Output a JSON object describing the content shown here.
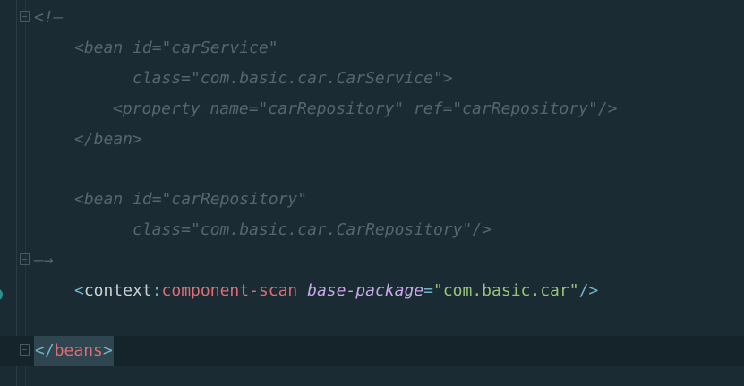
{
  "editor": {
    "lines": {
      "comment_open": "<!—",
      "bean1_open": "<bean id=\"carService\"",
      "bean1_class": "class=\"com.basic.car.CarService\">",
      "bean1_prop": "<property name=\"carRepository\" ref=\"carRepository\"/>",
      "bean1_close": "</bean>",
      "bean2_open": "<bean id=\"carRepository\"",
      "bean2_class": "class=\"com.basic.car.CarRepository\"/>",
      "comment_close": "—→",
      "scan": {
        "lt": "<",
        "ns": "context",
        "colon": ":",
        "tag": "component-scan",
        "attr": "base-package",
        "eq": "=",
        "value": "\"com.basic.car\"",
        "close": "/>"
      },
      "beans_close": {
        "lt": "</",
        "tag": "beans",
        "gt": ">"
      }
    }
  },
  "colors": {
    "background": "#1a2b33",
    "comment": "#56666d",
    "punctuation": "#6fb6c4",
    "tag": "#e06c75",
    "attribute": "#c9a8e8",
    "string": "#98c379",
    "current_line": "#15232a"
  }
}
